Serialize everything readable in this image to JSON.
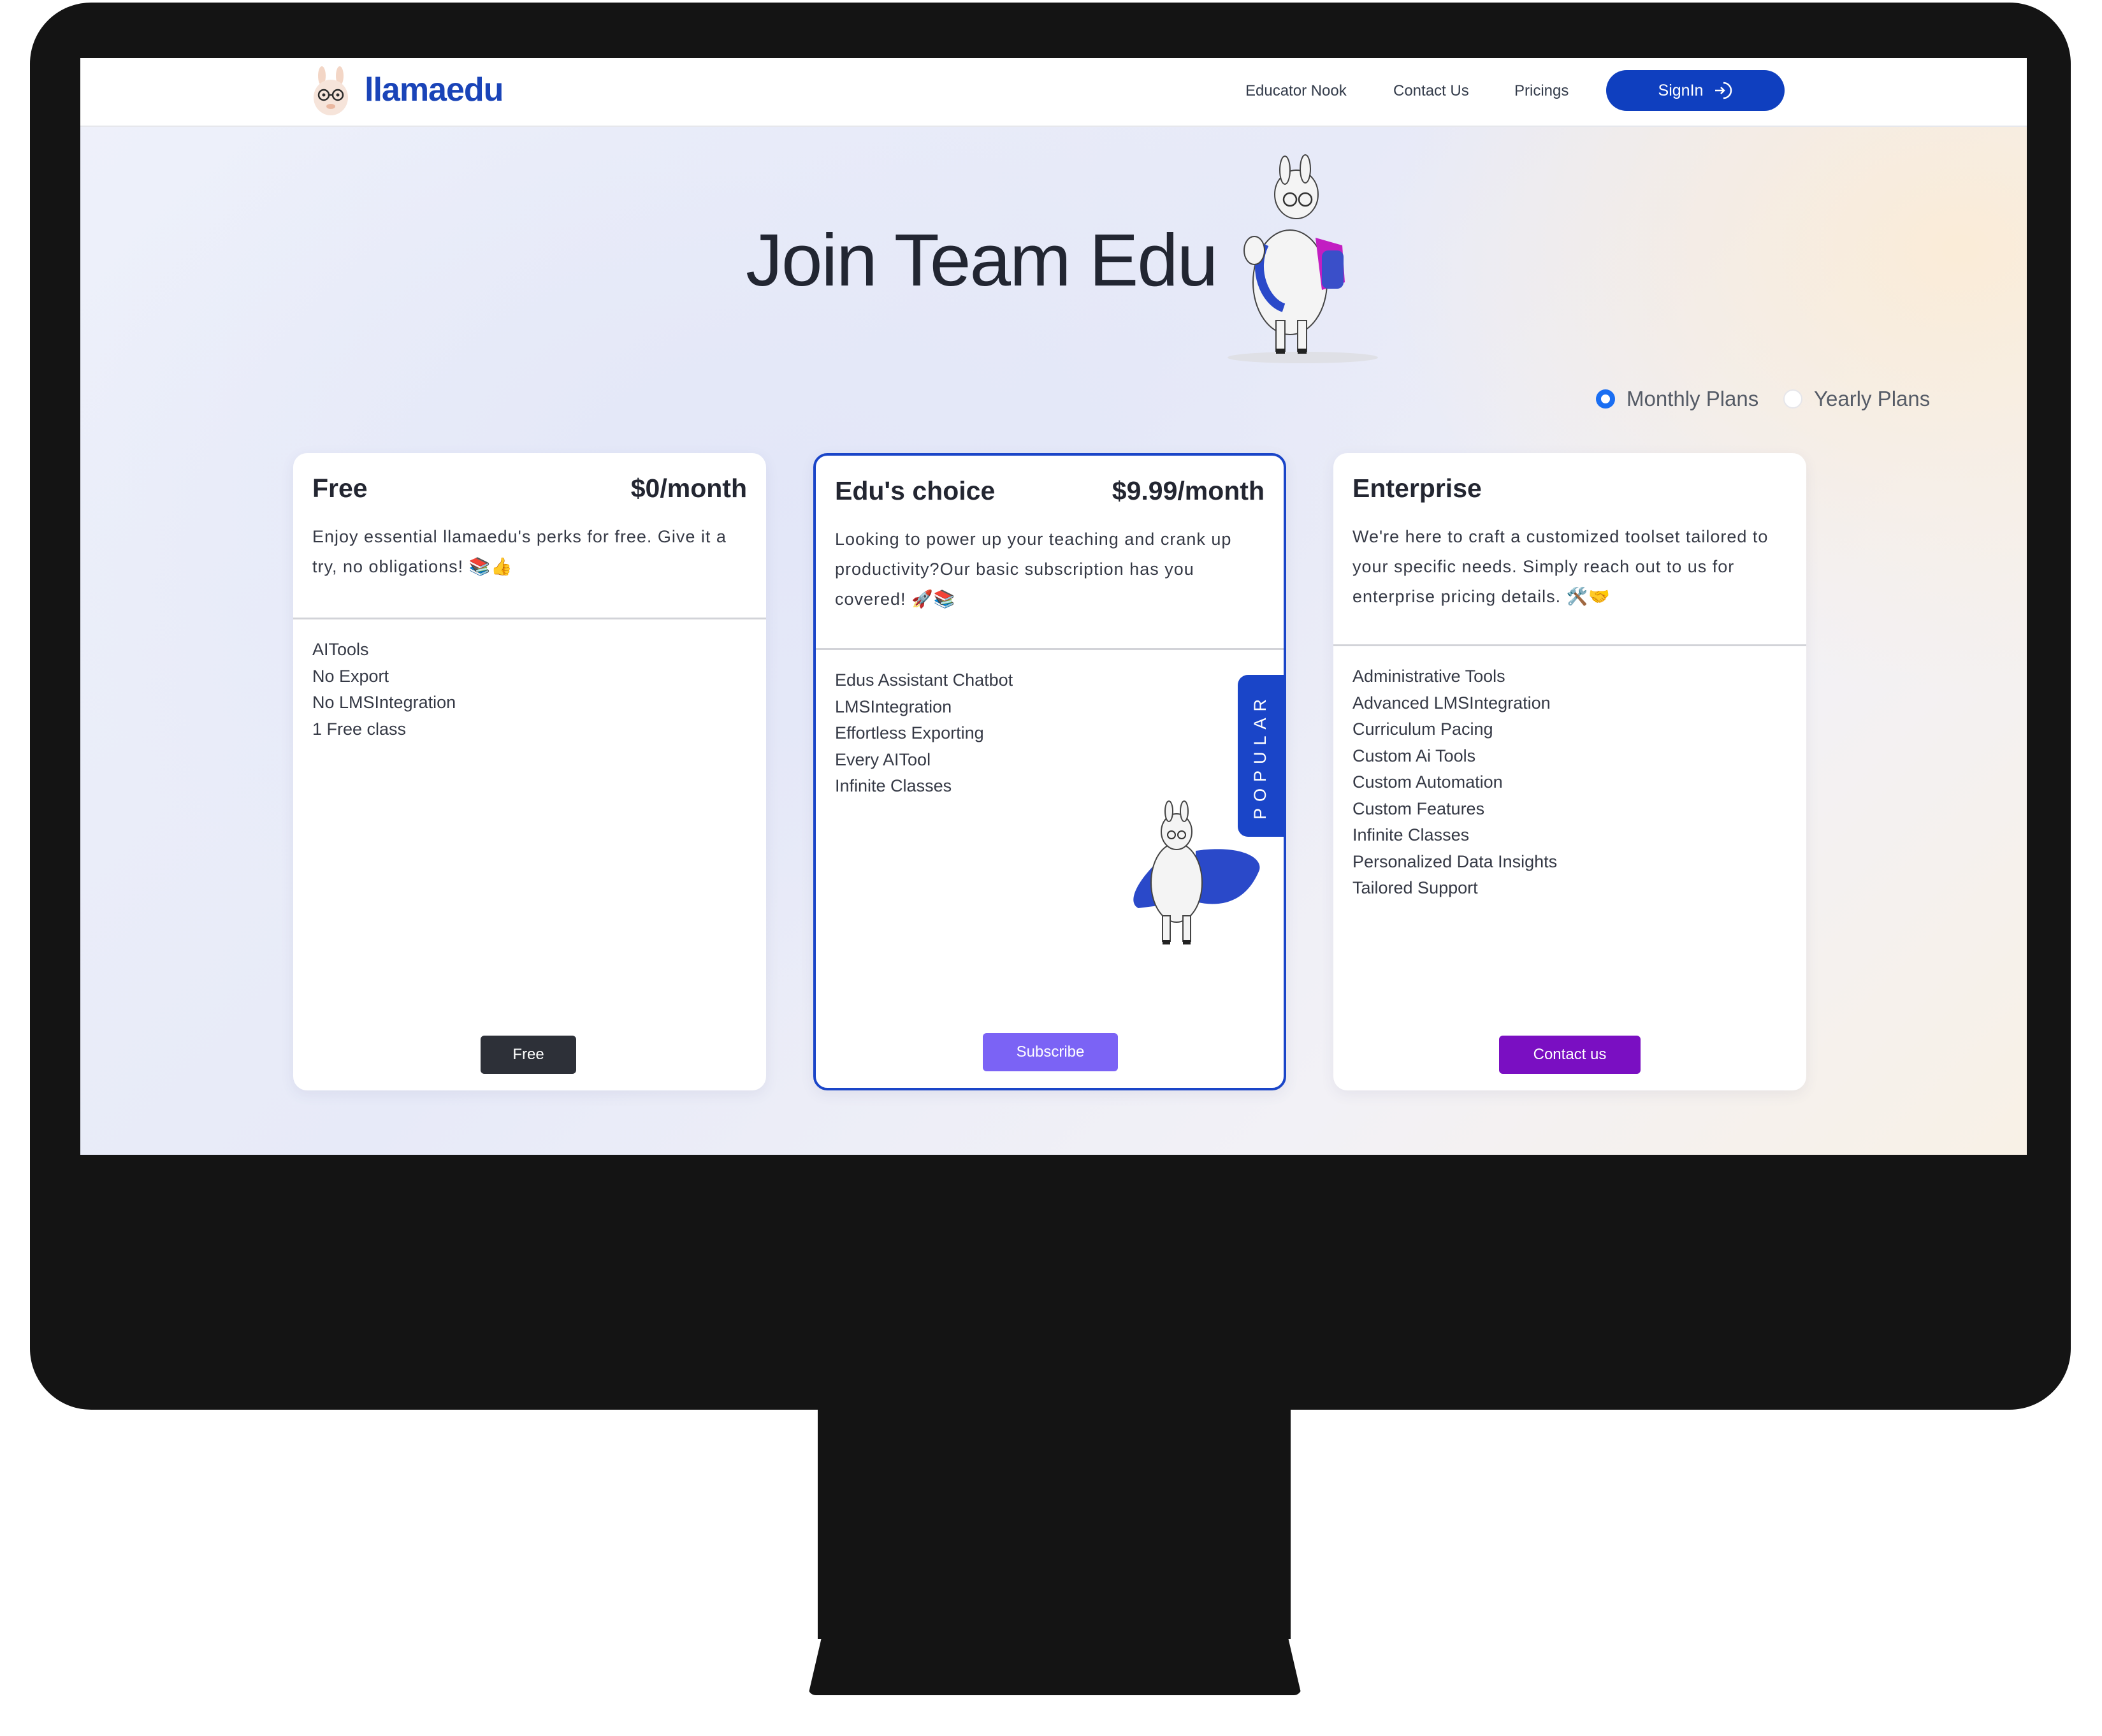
{
  "nav": {
    "brand": "llamaedu",
    "links": [
      "Educator Nook",
      "Contact Us",
      "Pricings"
    ],
    "signin_label": "SignIn"
  },
  "hero": {
    "title": "Join Team Edu"
  },
  "billing": {
    "options": [
      {
        "label": "Monthly Plans",
        "selected": true
      },
      {
        "label": "Yearly Plans",
        "selected": false
      }
    ]
  },
  "plans": [
    {
      "name": "Free",
      "price": "$0/month",
      "description": "Enjoy essential llamaedu's perks for free. Give it a try, no obligations! 📚👍",
      "features": [
        "AITools",
        "No Export",
        "No LMSIntegration",
        "1 Free class"
      ],
      "button_label": "Free",
      "button_color": "#2d3038"
    },
    {
      "name": "Edu's choice",
      "price": "$9.99/month",
      "description": "Looking to power up your teaching and crank up productivity?Our basic subscription has you covered! 🚀📚",
      "features": [
        "Edus Assistant Chatbot",
        "LMSIntegration",
        "Effortless Exporting",
        "Every AITool",
        "Infinite Classes"
      ],
      "badge": "POPULAR",
      "button_label": "Subscribe",
      "button_color": "#7b63f5"
    },
    {
      "name": "Enterprise",
      "price": "",
      "description": "We're here to craft a customized toolset tailored to your specific needs. Simply reach out to us for enterprise pricing details. 🛠️🤝",
      "features": [
        "Administrative Tools",
        "Advanced LMSIntegration",
        "Curriculum Pacing",
        "Custom Ai Tools",
        "Custom Automation",
        "Custom Features",
        "Infinite Classes",
        "Personalized Data Insights",
        "Tailored Support"
      ],
      "button_label": "Contact us",
      "button_color": "#7a0fc2"
    }
  ],
  "colors": {
    "brand": "#1a44b8",
    "accent": "#0f3fbf",
    "featured_border": "#1a45c8",
    "radio": "#1a6ef2"
  },
  "icons": {
    "signin": "sign-in-arrow-icon",
    "logo": "llama-logo-icon"
  }
}
